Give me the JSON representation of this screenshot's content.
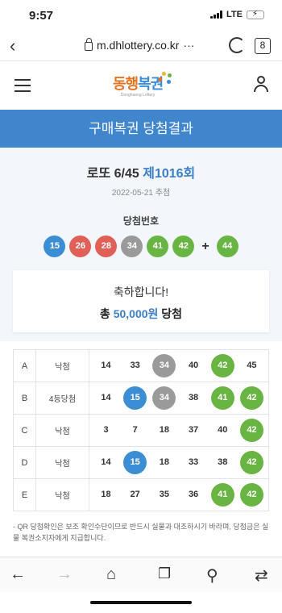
{
  "status": {
    "time": "9:57",
    "network": "LTE"
  },
  "browser": {
    "url": "m.dhlottery.co.kr",
    "url_more": "···",
    "tab_count": "8"
  },
  "brand": {
    "logo_text_1": "동행",
    "logo_text_2": "복권",
    "logo_sub": "Donghaeng Lottery"
  },
  "banner": {
    "title": "구매복권 당첨결과"
  },
  "draw": {
    "game": "로또 6/45",
    "round": "제1016회",
    "date": "2022-05-21 추첨",
    "win_label": "당첨번호",
    "numbers": [
      "15",
      "26",
      "28",
      "34",
      "41",
      "42"
    ],
    "number_colors": [
      "#3b8ed4",
      "#e05f56",
      "#e05f56",
      "#9a9a9a",
      "#68b544",
      "#68b544"
    ],
    "plus": "+",
    "bonus": "44",
    "bonus_color": "#68b544"
  },
  "congrats": {
    "line1": "축하합니다!",
    "prefix": "총",
    "amount": "50,000원",
    "suffix": "당첨"
  },
  "games": [
    {
      "label": "A",
      "result": "낙첨",
      "nums": [
        "14",
        "33",
        "34",
        "40",
        "42",
        "45"
      ],
      "hits": [
        false,
        false,
        true,
        false,
        true,
        false
      ]
    },
    {
      "label": "B",
      "result": "4등당첨",
      "nums": [
        "14",
        "15",
        "34",
        "38",
        "41",
        "42"
      ],
      "hits": [
        false,
        true,
        true,
        false,
        true,
        true
      ]
    },
    {
      "label": "C",
      "result": "낙첨",
      "nums": [
        "3",
        "7",
        "18",
        "37",
        "40",
        "42"
      ],
      "hits": [
        false,
        false,
        false,
        false,
        false,
        true
      ]
    },
    {
      "label": "D",
      "result": "낙첨",
      "nums": [
        "14",
        "15",
        "18",
        "33",
        "38",
        "42"
      ],
      "hits": [
        false,
        true,
        false,
        false,
        false,
        true
      ]
    },
    {
      "label": "E",
      "result": "낙첨",
      "nums": [
        "18",
        "27",
        "35",
        "36",
        "41",
        "42"
      ],
      "hits": [
        false,
        false,
        false,
        false,
        true,
        true
      ]
    }
  ],
  "ball_colors": {
    "15": "#3b8ed4",
    "34": "#9a9a9a",
    "41": "#68b544",
    "42": "#68b544"
  },
  "notice": "- QR 당첨확인은 보조 확인수단이므로 반드시 실물과 대조하시기 바라며, 당첨금은 실물 복권소지자에게 지급합니다.",
  "toolbar": {
    "back": "back-arrow-icon",
    "forward": "forward-arrow-icon",
    "home": "home-icon",
    "bookmark": "bookmark-icon",
    "search": "search-icon",
    "share": "share-icon"
  }
}
